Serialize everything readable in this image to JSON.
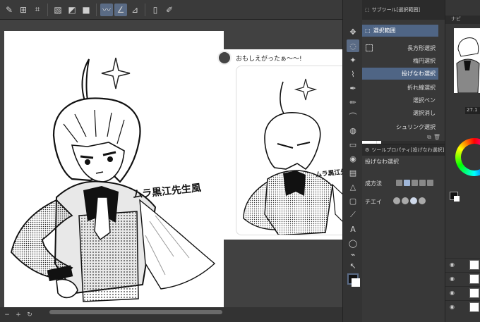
{
  "tweet": {
    "text": "おもしえがったぁ〜〜!"
  },
  "subtool": {
    "tab_label": "サブツール[選択範囲]",
    "group_label": "選択範囲",
    "items": [
      {
        "label": "長方形選択"
      },
      {
        "label": "楕円選択"
      },
      {
        "label": "投げなわ選択"
      },
      {
        "label": "折れ線選択"
      },
      {
        "label": "選択ペン"
      },
      {
        "label": "選択消し"
      },
      {
        "label": "シュリンク選択"
      }
    ],
    "selected_index": 2
  },
  "tool_property": {
    "tab_label": "ツールプロパティ[投げなわ選択]",
    "title": "投げなわ選択",
    "rows": [
      {
        "label": "成方法"
      },
      {
        "label": "チエイ"
      }
    ]
  },
  "navigator": {
    "tab_label": "ナビ",
    "zoom": "27.1"
  },
  "artwork": {
    "caption": "ムラ黒江先生風"
  },
  "colors": {
    "accent": "#4f6585",
    "panel": "#383838",
    "canvas_bg": "#414141",
    "squiggle": "#ffffff"
  }
}
